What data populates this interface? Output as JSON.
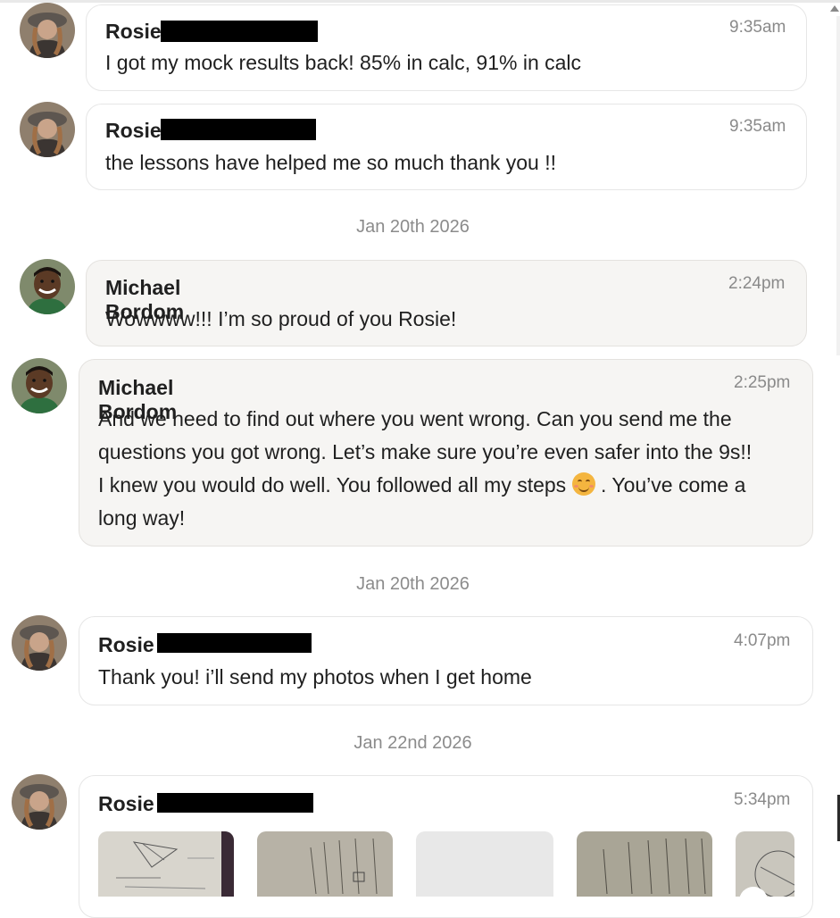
{
  "colors": {
    "bubble_border": "#e6e6e6",
    "tutor_bubble_bg": "#f6f5f3",
    "timestamp": "#8a8a8a",
    "redaction": "#000000"
  },
  "messages": [
    {
      "sender": "Rosie",
      "time": "9:35am",
      "text": "I got my mock results back! 85% in calc, 91% in calc",
      "avatar": "student-avatar"
    },
    {
      "sender": "Rosie",
      "time": "9:35am",
      "text": "the lessons have helped me so much thank you !!",
      "avatar": "student-avatar"
    },
    {
      "sender": "Michael Bordom",
      "time": "2:24pm",
      "text": "Wowwww!!! I’m so proud of you Rosie!",
      "avatar": "tutor-avatar"
    },
    {
      "sender": "Michael Bordom",
      "time": "2:25pm",
      "avatar": "tutor-avatar",
      "lines": [
        "And we need to find out where you went wrong. Can you send me the",
        "questions you got wrong. Let’s make sure you’re even safer into the 9s!!",
        "I knew you would do well. You followed all my steps",
        ". You’ve come a",
        "long way!"
      ],
      "emoji": "smiling-face-emoji"
    },
    {
      "sender": "Rosie",
      "time": "4:07pm",
      "text": "Thank you! i’ll send my photos when I get home",
      "avatar": "student-avatar"
    },
    {
      "sender": "Rosie",
      "time": "5:34pm",
      "avatar": "student-avatar",
      "attachments": [
        "photo-geometry-worksheet",
        "photo-handwritten-notes",
        "photo-loading",
        "photo-lined-notes",
        "photo-circle-diagram"
      ]
    }
  ],
  "dividers": [
    "Jan 20th 2026",
    "Jan 20th 2026",
    "Jan 22nd 2026"
  ]
}
